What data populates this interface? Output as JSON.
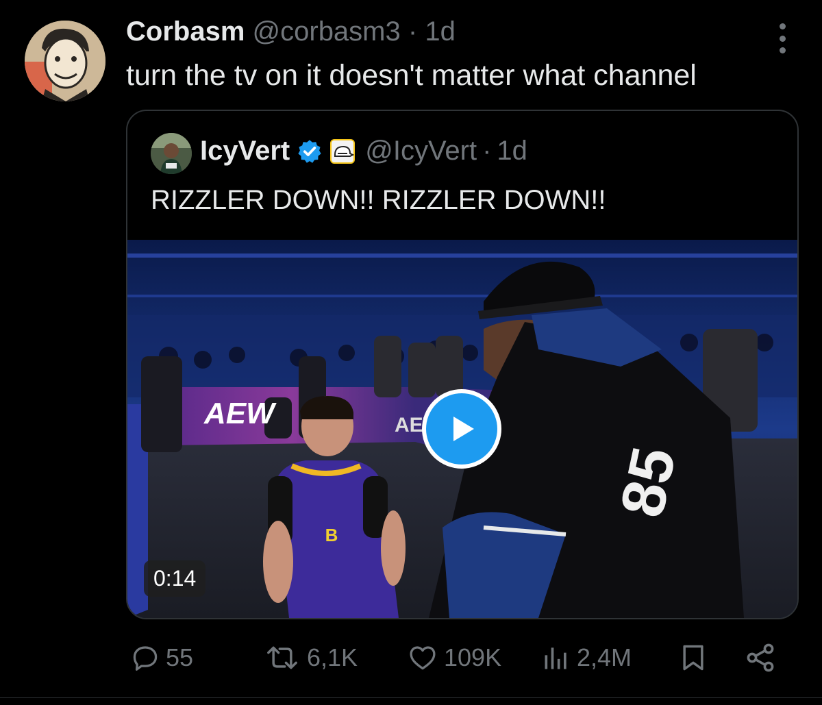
{
  "post": {
    "author_name": "Corbasm",
    "handle": "@corbasm3",
    "separator": "·",
    "time": "1d",
    "text": "turn the tv on it doesn't matter what channel"
  },
  "quoted": {
    "author_name": "IcyVert",
    "handle": "@IcyVert",
    "separator": "·",
    "time": "1d",
    "text": "RIZZLER DOWN!! RIZZLER DOWN!!",
    "video": {
      "duration": "0:14",
      "overlay_text": [
        "AEW",
        "AEW",
        "85"
      ]
    }
  },
  "actions": {
    "replies": "55",
    "reposts": "6,1K",
    "likes": "109K",
    "views": "2,4M"
  },
  "colors": {
    "background": "#000000",
    "text": "#e7e9ea",
    "muted": "#71767b",
    "accent": "#1d9bf0",
    "border": "#2f3336"
  },
  "icons": [
    "more-icon",
    "verified-icon",
    "cap-badge-icon",
    "play-icon",
    "reply-icon",
    "repost-icon",
    "like-icon",
    "views-icon",
    "bookmark-icon",
    "share-icon"
  ]
}
